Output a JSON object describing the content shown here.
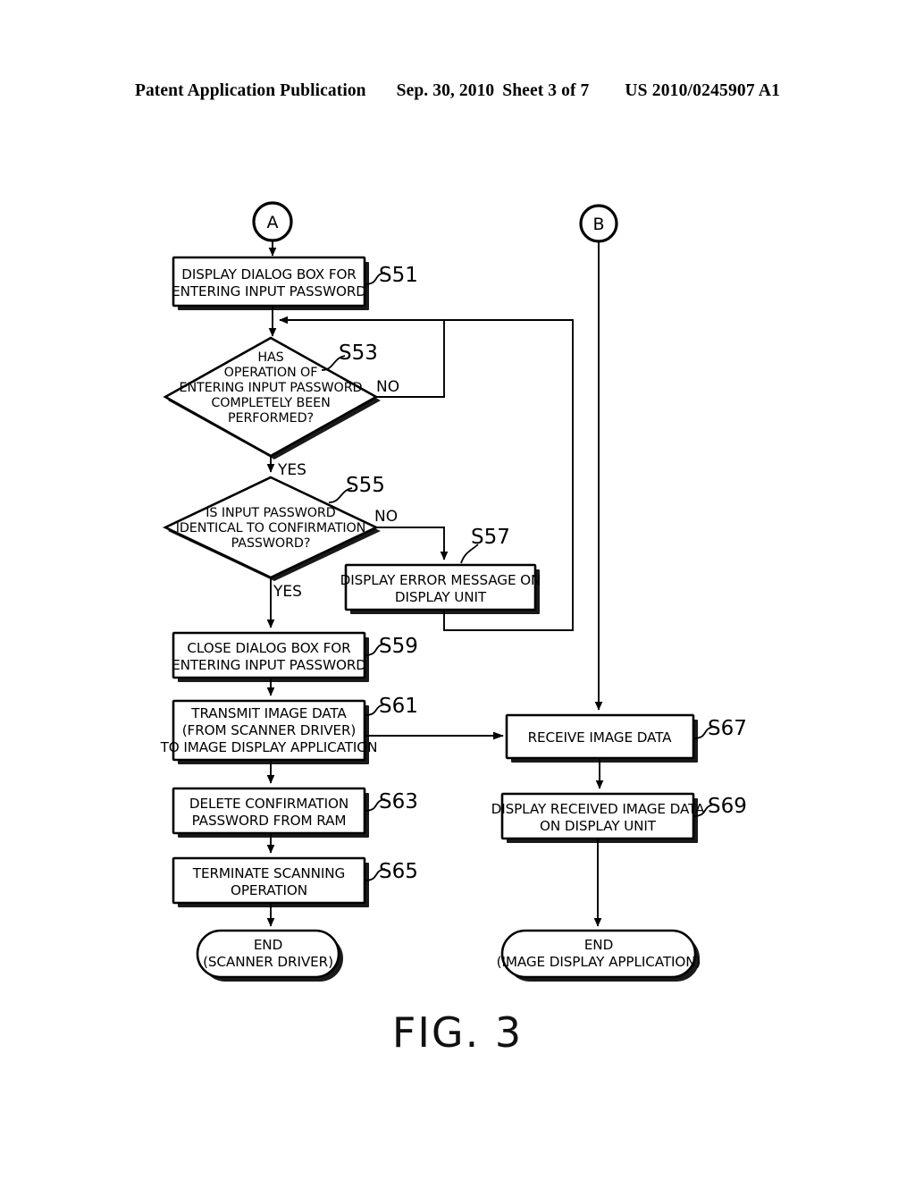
{
  "header": {
    "publication": "Patent Application Publication",
    "date": "Sep. 30, 2010",
    "sheet": "Sheet 3 of 7",
    "number": "US 2010/0245907 A1"
  },
  "figure": {
    "caption": "FIG. 3"
  },
  "connectors": {
    "a": "A",
    "b": "B"
  },
  "branches": {
    "s53_no": "NO",
    "s53_yes": "YES",
    "s55_no": "NO",
    "s55_yes": "YES"
  },
  "steps": {
    "s51": {
      "label": "S51",
      "lines": [
        "DISPLAY DIALOG BOX FOR",
        "ENTERING INPUT PASSWORD"
      ]
    },
    "s53": {
      "label": "S53",
      "lines": [
        "HAS",
        "OPERATION OF",
        "ENTERING INPUT PASSWORD",
        "COMPLETELY BEEN",
        "PERFORMED?"
      ]
    },
    "s55": {
      "label": "S55",
      "lines": [
        "IS INPUT PASSWORD",
        "IDENTICAL TO CONFIRMATION",
        "PASSWORD?"
      ]
    },
    "s57": {
      "label": "S57",
      "lines": [
        "DISPLAY ERROR MESSAGE ON",
        "DISPLAY UNIT"
      ]
    },
    "s59": {
      "label": "S59",
      "lines": [
        "CLOSE DIALOG BOX FOR",
        "ENTERING INPUT PASSWORD"
      ]
    },
    "s61": {
      "label": "S61",
      "lines": [
        "TRANSMIT IMAGE DATA",
        "(FROM SCANNER DRIVER)",
        "TO IMAGE DISPLAY APPLICATION"
      ]
    },
    "s63": {
      "label": "S63",
      "lines": [
        "DELETE CONFIRMATION",
        "PASSWORD FROM RAM"
      ]
    },
    "s65": {
      "label": "S65",
      "lines": [
        "TERMINATE SCANNING",
        "OPERATION"
      ]
    },
    "s67": {
      "label": "S67",
      "lines": [
        "RECEIVE IMAGE DATA"
      ]
    },
    "s69": {
      "label": "S69",
      "lines": [
        "DISPLAY RECEIVED IMAGE DATA",
        "ON DISPLAY UNIT"
      ]
    }
  },
  "terminators": {
    "end_scanner": {
      "lines": [
        "END",
        "(SCANNER DRIVER)"
      ]
    },
    "end_app": {
      "lines": [
        "END",
        "(IMAGE DISPLAY APPLICATION)"
      ]
    }
  },
  "colors": {
    "ink": "#000000",
    "paper": "#ffffff"
  }
}
